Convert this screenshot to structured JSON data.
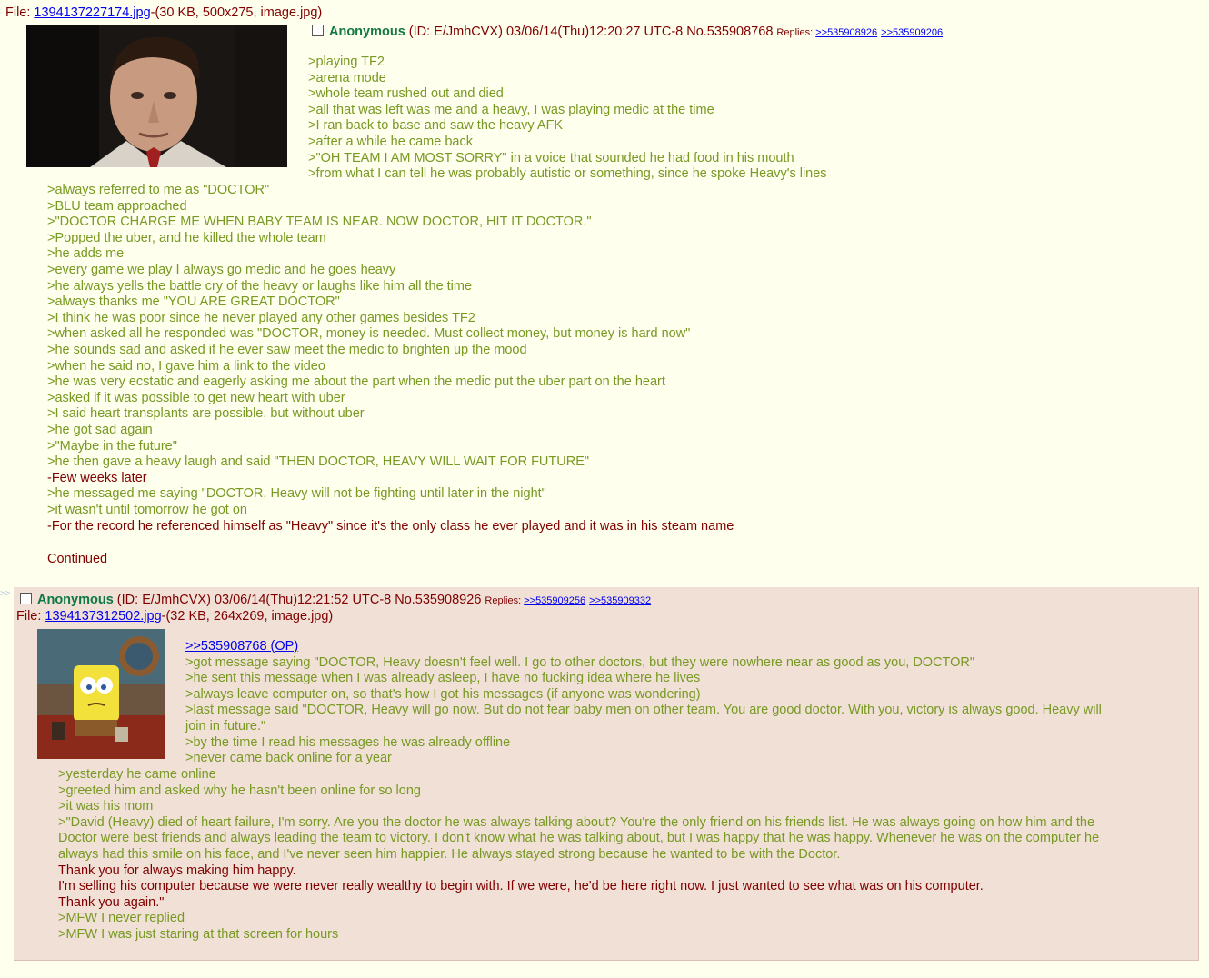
{
  "op": {
    "file_label": "File: ",
    "file_name": "1394137227174.jpg",
    "file_meta": "-(30 KB, 500x275, image.jpg)",
    "name": "Anonymous",
    "post_meta": " (ID: E/JmhCVX) 03/06/14(Thu)12:20:27 UTC-8 No.535908768 ",
    "replies_label": "Replies: ",
    "replies": [
      ">>535908926",
      ">>535909206"
    ],
    "lines_right": [
      ">playing TF2",
      ">arena mode",
      ">whole team rushed out and died",
      ">all that was left was me and a heavy, I was playing medic at the time",
      ">I ran back to base and saw the heavy AFK",
      ">after a while he came back",
      ">\"OH TEAM I AM MOST SORRY\" in a voice that sounded he had food in his mouth",
      ">from what I can tell he was probably autistic or something, since he spoke Heavy's lines"
    ],
    "lines_full": [
      ">always referred to me as \"DOCTOR\"",
      ">BLU team approached",
      ">\"DOCTOR CHARGE ME WHEN BABY TEAM IS NEAR. NOW DOCTOR, HIT IT DOCTOR.\"",
      ">Popped the uber, and he killed the whole team",
      ">he adds me",
      ">every game we play I always go medic and he goes heavy",
      ">he always yells the battle cry of the heavy or laughs like him all the time",
      ">always thanks me \"YOU ARE GREAT DOCTOR\"",
      ">I think he was poor since he never played any other games besides TF2",
      ">when asked all he responded was \"DOCTOR, money is needed. Must collect money, but money is hard now\"",
      ">he sounds sad and asked if he ever saw meet the medic to brighten up the mood",
      ">when he said no, I gave him a link to the video",
      ">he was very ecstatic and eagerly asking me about the part when the medic put the uber part on the heart",
      ">asked if it was possible to get new heart with uber",
      ">I said heart transplants are possible, but without uber",
      ">he got sad again",
      ">\"Maybe in the future\"",
      ">he then gave a heavy laugh and said \"THEN DOCTOR, HEAVY WILL WAIT FOR FUTURE\"",
      "-Few weeks later",
      ">he messaged me saying \"DOCTOR, Heavy will not be fighting until later in the night\"",
      ">it wasn't until tomorrow he got on",
      "-For the record he referenced himself as \"Heavy\" since it's the only class he ever played and it was in his steam name",
      "",
      "Continued"
    ]
  },
  "reply": {
    "arrows": ">>",
    "name": "Anonymous",
    "post_meta": " (ID: E/JmhCVX) 03/06/14(Thu)12:21:52 UTC-8 No.535908926 ",
    "replies_label": "Replies: ",
    "replies": [
      ">>535909256",
      ">>535909332"
    ],
    "file_label": "File: ",
    "file_name": "1394137312502.jpg",
    "file_meta": "-(32 KB, 264x269, image.jpg)",
    "quote_link": ">>535908768 (OP)",
    "lines_right": [
      ">got message saying \"DOCTOR, Heavy doesn't feel well. I go to other doctors, but they were nowhere near as good as you, DOCTOR\"",
      ">he sent this message when I was already asleep, I have no fucking idea where he lives",
      ">always leave computer on, so that's how I got his messages (if anyone was wondering)",
      ">last message said \"DOCTOR, Heavy will go now. But do not fear baby men on other team. You are good doctor. With you, victory is always good. Heavy will",
      "join in future.\"",
      ">by the time I read his messages he was already offline",
      ">never came back online for a year"
    ],
    "lines_full": [
      ">yesterday he came online",
      ">greeted him and asked why he hasn't been online for so long",
      ">it was his mom",
      ">\"David (Heavy) died of heart failure, I'm sorry. Are you the doctor he was always talking about? You're the only friend on his friends list. He was always going on how him and the",
      "Doctor were best friends and always leading the team to victory. I don't know what he was talking about, but I was happy that he was happy. Whenever he was on the computer he",
      "always had this smile on his face, and I've never seen him happier. He always stayed strong because he wanted to be with the Doctor.",
      "Thank you for always making him happy.",
      "I'm selling his computer because we were never really wealthy to begin with. If we were, he'd be here right now. I just wanted to see what was on his computer.",
      "Thank you again.\"",
      ">MFW I never replied",
      ">MFW I was just staring at that screen for hours"
    ],
    "lines_full_greentext": [
      true,
      true,
      true,
      true,
      true,
      true,
      false,
      false,
      false,
      true,
      true
    ]
  },
  "colors": {
    "background": "#FFFFEE",
    "reply_background": "#F0E0D6",
    "greentext": "#789922",
    "name": "#117743",
    "text": "#800000",
    "link": "#0000EE"
  }
}
